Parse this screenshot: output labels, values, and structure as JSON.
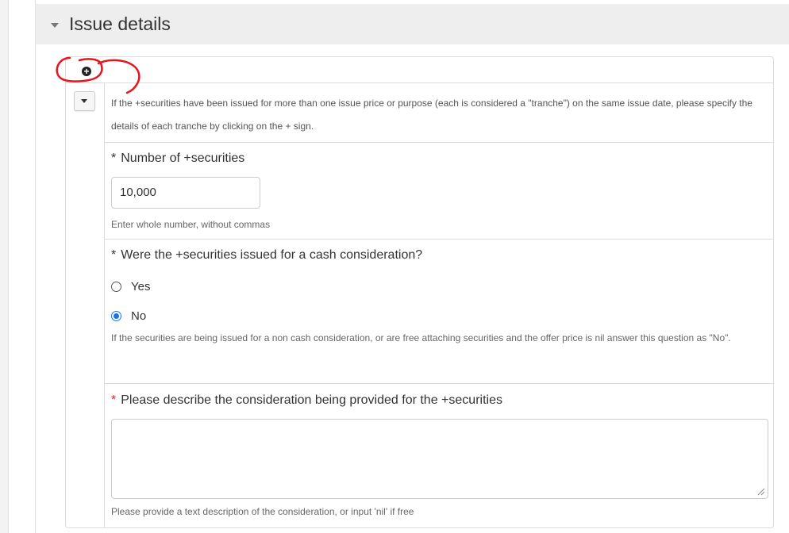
{
  "section": {
    "title": "Issue details"
  },
  "tranche": {
    "intro_text": "If the +securities have been issued for more than one issue price or purpose (each is considered a \"tranche\") on the same issue date, please specify the details of each tranche by clicking on the + sign.",
    "number_field": {
      "required_marker": "*",
      "label": "Number of +securities",
      "value": "10,000",
      "help": "Enter whole number, without commas"
    },
    "cash_consideration": {
      "required_marker": "*",
      "question": "Were the +securities issued for a cash consideration?",
      "options": [
        "Yes",
        "No"
      ],
      "selected": "No",
      "help": "If the securities are being issued for a non cash consideration, or are free attaching securities and the offer price is nil answer this question as \"No\"."
    },
    "consideration_desc": {
      "required_marker": "*",
      "label": "Please describe the consideration being provided for the +securities",
      "value": "",
      "help": "Please provide a text description of the consideration, or input 'nil' if free"
    }
  },
  "icons": {
    "add": "plus-circle-icon",
    "collapse": "caret-down-icon",
    "section_toggle": "caret-down-icon"
  },
  "colors": {
    "required_red": "#c9302c",
    "radio_blue": "#1a73e8",
    "annotation_red": "#e8141c"
  }
}
